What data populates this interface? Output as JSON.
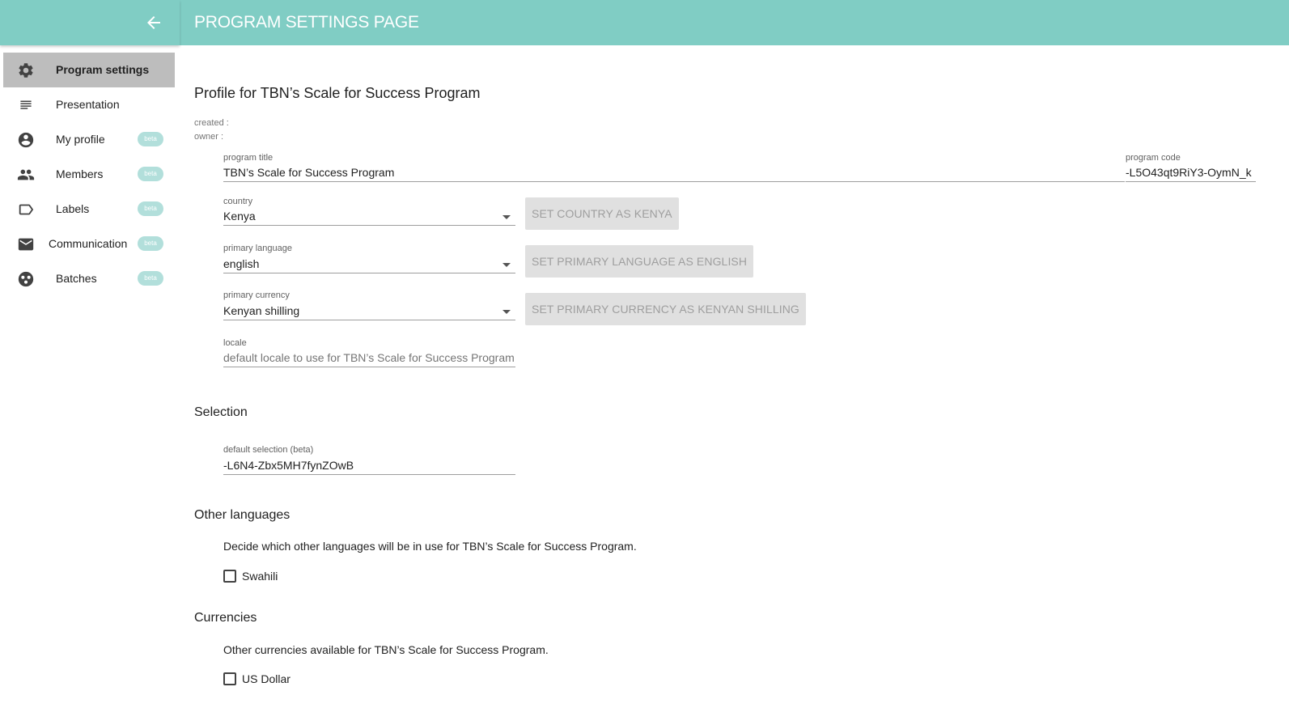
{
  "header": {
    "title": "PROGRAM SETTINGS PAGE",
    "back_icon": "arrow-back-icon"
  },
  "sidebar": {
    "items": [
      {
        "label": "Program settings",
        "icon": "gear-icon",
        "active": true,
        "badge": ""
      },
      {
        "label": "Presentation",
        "icon": "lines-icon",
        "active": false,
        "badge": ""
      },
      {
        "label": "My profile",
        "icon": "account-circle-icon",
        "active": false,
        "badge": "beta"
      },
      {
        "label": "Members",
        "icon": "people-icon",
        "active": false,
        "badge": "beta"
      },
      {
        "label": "Labels",
        "icon": "label-icon",
        "active": false,
        "badge": "beta"
      },
      {
        "label": "Communication",
        "icon": "mail-icon",
        "active": false,
        "badge": "beta"
      },
      {
        "label": "Batches",
        "icon": "batches-icon",
        "active": false,
        "badge": "beta"
      }
    ]
  },
  "profile": {
    "heading": "Profile for TBN’s Scale for Success Program",
    "created_label": "created :",
    "owner_label": "owner :",
    "program_title": {
      "label": "program title",
      "value": "TBN’s Scale for Success Program"
    },
    "program_code": {
      "label": "program code",
      "value": "-L5O43qt9RiY3-OymN_k"
    },
    "country": {
      "label": "country",
      "value": "Kenya",
      "button": "SET COUNTRY AS KENYA"
    },
    "primary_language": {
      "label": "primary language",
      "value": "english",
      "button": "SET PRIMARY LANGUAGE AS ENGLISH"
    },
    "primary_currency": {
      "label": "primary currency",
      "value": "Kenyan shilling",
      "button": "SET PRIMARY CURRENCY AS KENYAN SHILLING"
    },
    "locale": {
      "label": "locale",
      "placeholder": "default locale to use for TBN’s Scale for Success Program"
    }
  },
  "selection": {
    "heading": "Selection",
    "default_selection": {
      "label": "default selection (beta)",
      "value": "-L6N4-Zbx5MH7fynZOwB"
    }
  },
  "other_languages": {
    "heading": "Other languages",
    "description": "Decide which other languages will be in use for TBN’s Scale for Success Program.",
    "options": [
      {
        "label": "Swahili",
        "checked": false
      }
    ]
  },
  "currencies": {
    "heading": "Currencies",
    "description": "Other currencies available for TBN’s Scale for Success Program.",
    "options": [
      {
        "label": "US Dollar",
        "checked": false
      }
    ]
  },
  "colors": {
    "header": "#80cdc4",
    "badge": "#b2dfdb",
    "active_nav": "#bdbdbd"
  }
}
